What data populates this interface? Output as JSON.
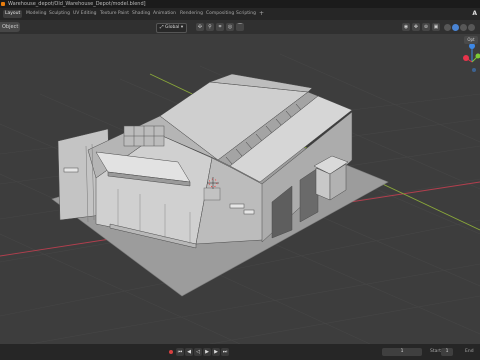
{
  "window": {
    "title": "Warehouse_depot/Old_Warehouse_Depot/model.blend]"
  },
  "workspaces": {
    "tabs": [
      "Layout",
      "Modeling",
      "Sculpting",
      "UV Editing",
      "Texture Paint",
      "Shading",
      "Animation",
      "Rendering",
      "Compositing",
      "Scripting"
    ],
    "active": "Layout",
    "add_label": "+"
  },
  "topright": {
    "label": "A"
  },
  "header": {
    "mode": "Object",
    "transform_orientation": "Global",
    "options_label": "Opt"
  },
  "timeline": {
    "current_frame": "1",
    "start_label": "Start",
    "start_value": "1",
    "end_label": "End"
  },
  "colors": {
    "grid_x_axis": "#b33f4e",
    "grid_y_axis": "#8aa83a",
    "gizmo_x": "#e8344b",
    "gizmo_y": "#7ecc36",
    "gizmo_z": "#3d88e6",
    "active_shading": "#4a84d4",
    "viewport_bg": "#3d3d3d"
  },
  "icons": [
    "cursor-icon",
    "gizmo-axes-icon",
    "play-icon",
    "record-icon",
    "snap-icon",
    "proportional-edit-icon"
  ]
}
